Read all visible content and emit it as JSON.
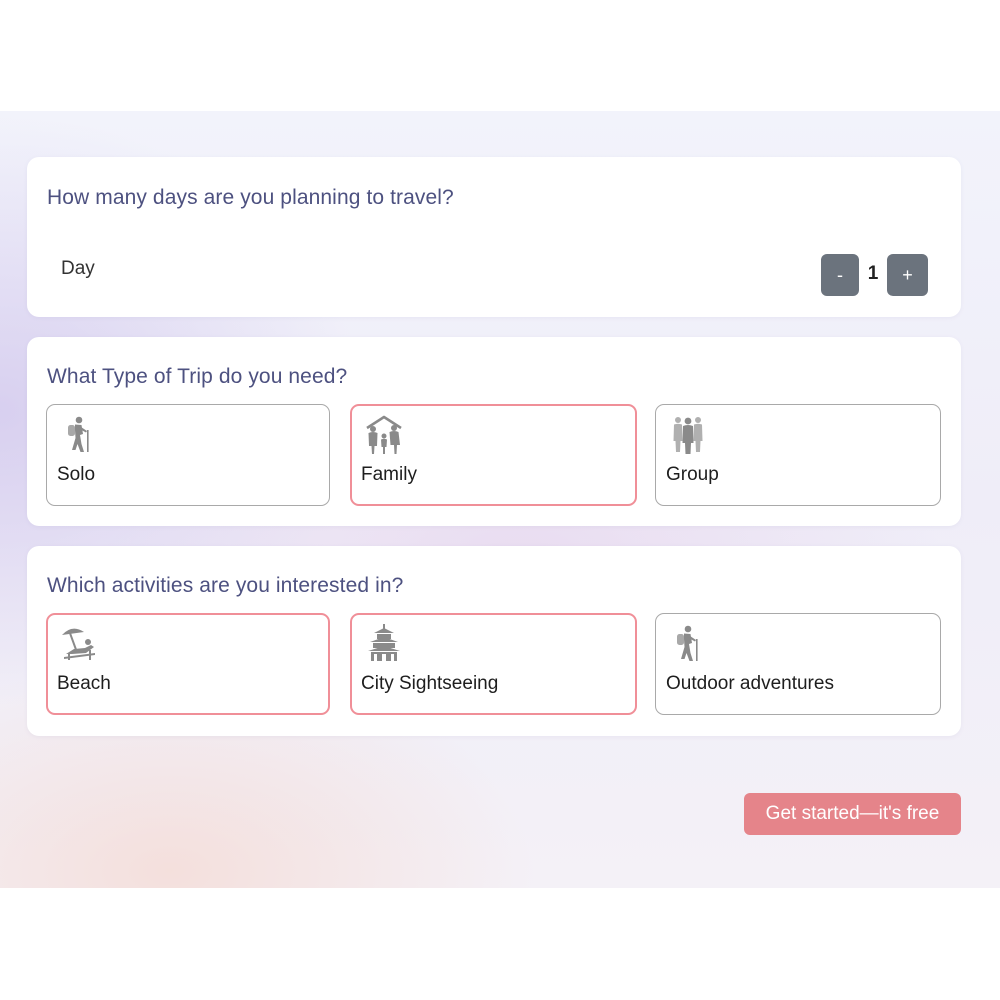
{
  "days_section": {
    "question": "How many days are you planning to travel?",
    "unit_label": "Day",
    "stepper": {
      "decrement_label": "-",
      "value": "1",
      "increment_label": "+"
    }
  },
  "trip_type_section": {
    "question": "What Type of Trip do you need?",
    "options": [
      {
        "label": "Solo",
        "icon": "hiker-icon",
        "selected": false
      },
      {
        "label": "Family",
        "icon": "family-icon",
        "selected": true
      },
      {
        "label": "Group",
        "icon": "group-icon",
        "selected": false
      }
    ]
  },
  "activities_section": {
    "question": "Which activities are you interested in?",
    "options": [
      {
        "label": "Beach",
        "icon": "beach-lounger-icon",
        "selected": true
      },
      {
        "label": "City Sightseeing",
        "icon": "temple-icon",
        "selected": true
      },
      {
        "label": "Outdoor adventures",
        "icon": "hiker-icon",
        "selected": false
      }
    ]
  },
  "cta": {
    "label": "Get started—it's free"
  },
  "colors": {
    "question_text": "#4d5180",
    "selected_border": "#f08f98",
    "unselected_border": "#a9a9a9",
    "stepper_button": "#6b737d",
    "cta_background": "#e5848a",
    "icon_gray": "#8a8a8a"
  }
}
